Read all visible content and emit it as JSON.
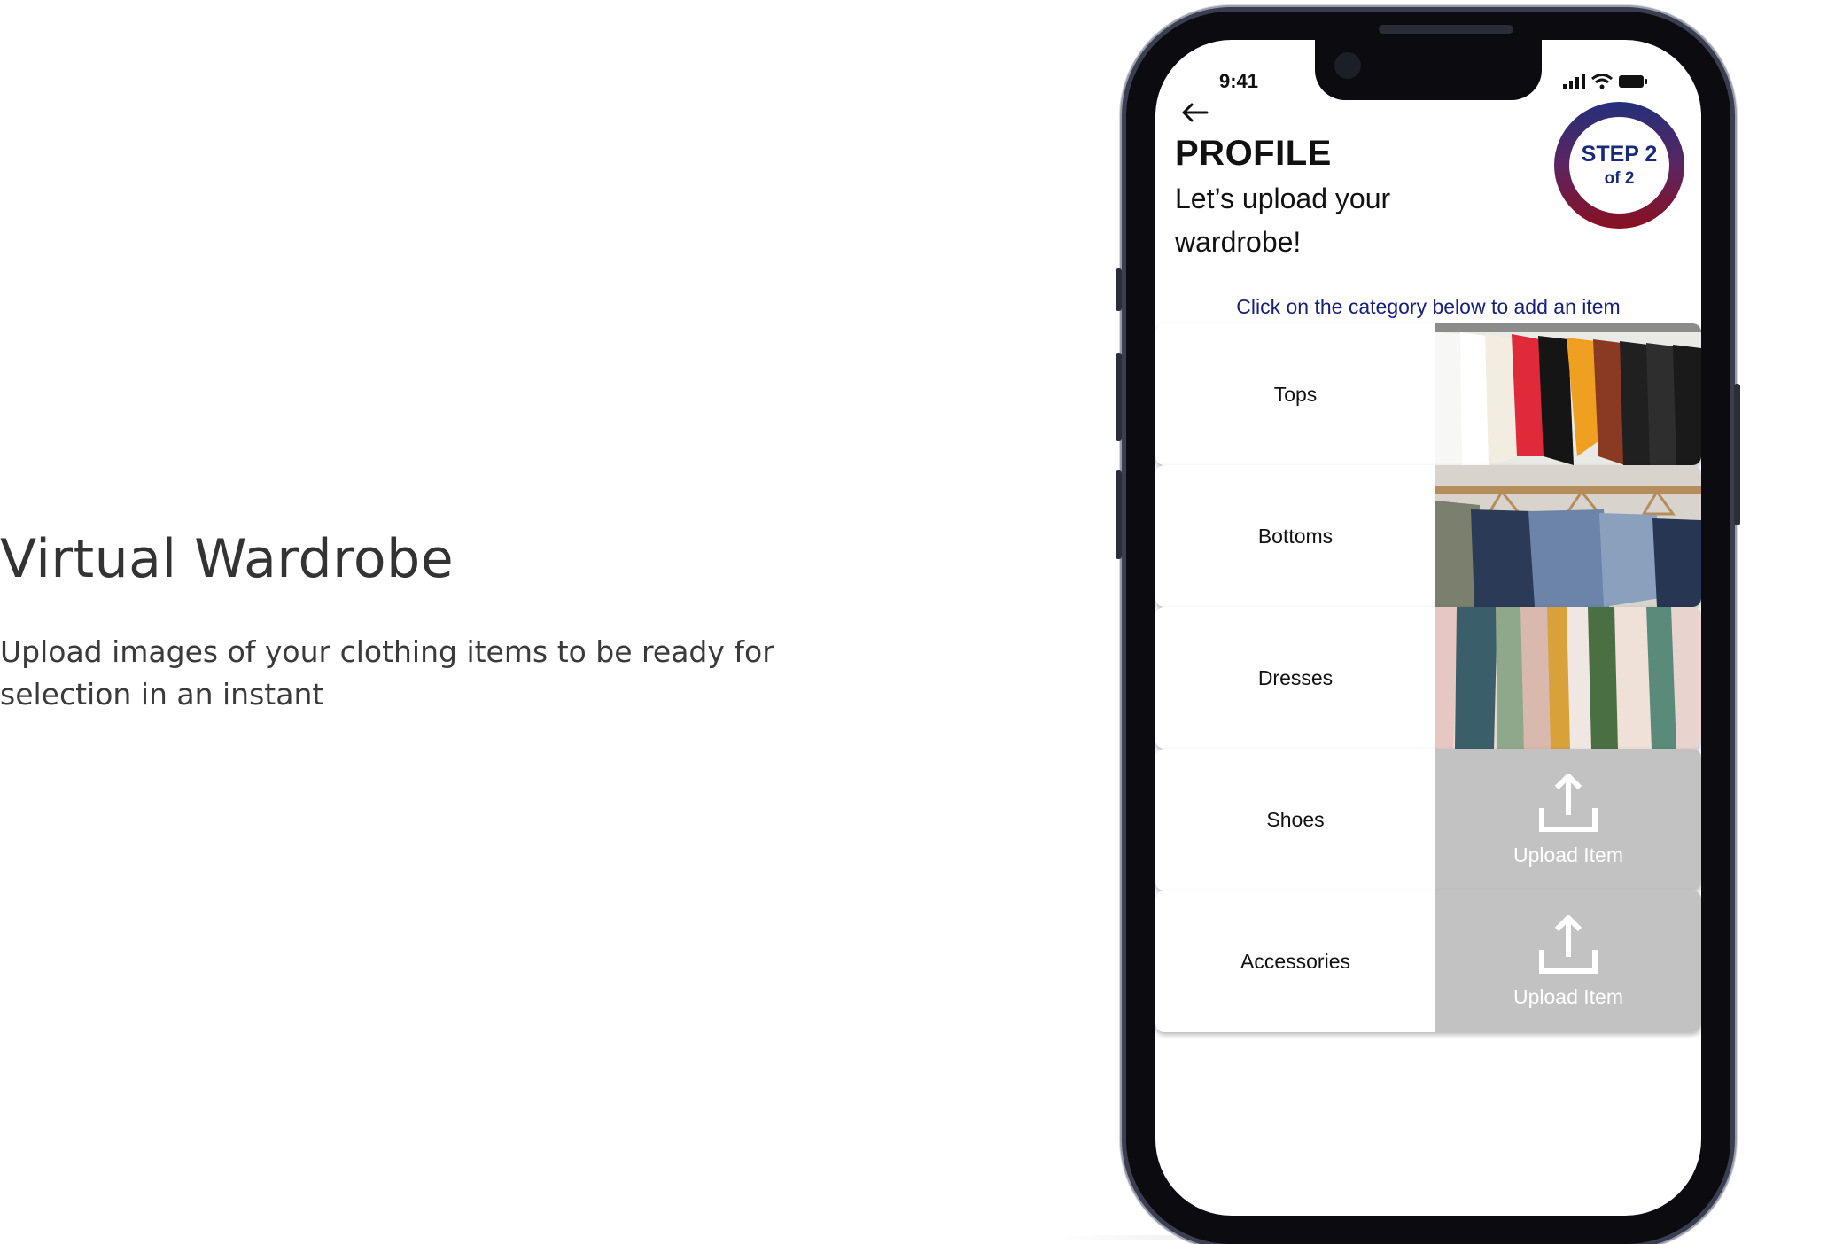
{
  "intro": {
    "title": "Virtual Wardrobe",
    "description": "Upload images of your clothing items to be ready for selection in an instant"
  },
  "status_bar": {
    "time": "9:41",
    "icons": [
      "signal-icon",
      "wifi-icon",
      "battery-icon"
    ]
  },
  "header": {
    "title": "PROFILE",
    "subtitle": "Let’s upload your wardrobe!",
    "step": {
      "line1": "STEP 2",
      "line2": "of 2"
    }
  },
  "instruction": "Click on the category below to add an item",
  "categories": [
    {
      "label": "Tops",
      "thumbnail": "tops-photo"
    },
    {
      "label": "Bottoms",
      "thumbnail": "bottoms-photo"
    },
    {
      "label": "Dresses",
      "thumbnail": "dresses-photo"
    },
    {
      "label": "Shoes",
      "upload_label": "Upload Item"
    },
    {
      "label": "Accessories",
      "upload_label": "Upload Item"
    }
  ],
  "colors": {
    "accent_navy": "#1a2a7a",
    "step_gradient_top": "#24307a",
    "step_gradient_bottom": "#8a1020",
    "upload_placeholder": "#c2c2c2"
  }
}
